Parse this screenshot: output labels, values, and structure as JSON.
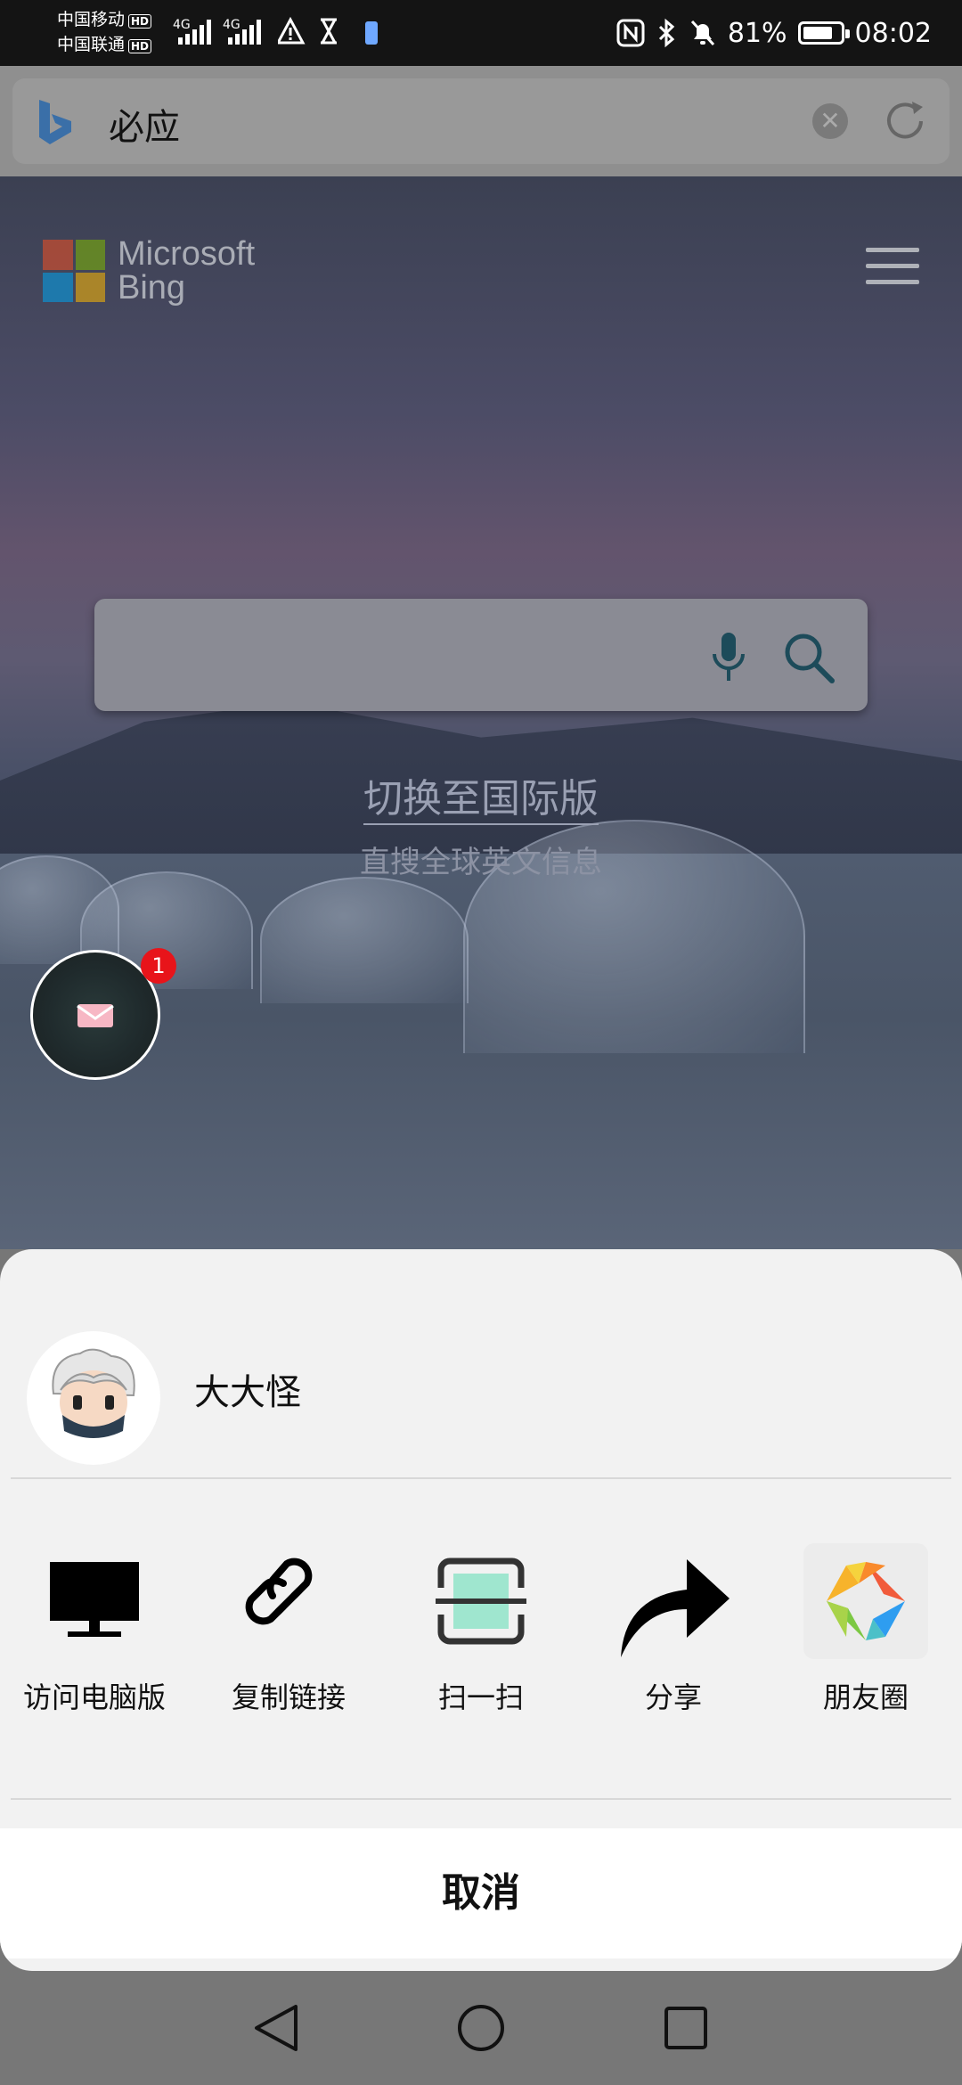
{
  "status_bar": {
    "carrier1": "中国移动",
    "carrier2": "中国联通",
    "hd": "HD",
    "net1": "4G",
    "net2": "4G",
    "battery_percent": "81%",
    "battery_level": 0.81,
    "time": "08:02"
  },
  "address_bar": {
    "text": "必应",
    "clear_icon": "clear-circle-icon",
    "reload_icon": "reload-icon"
  },
  "page": {
    "logo_line1": "Microsoft",
    "logo_line2": "Bing",
    "menu_icon": "hamburger-icon",
    "switch_intl": "切换至国际版",
    "switch_sub": "直搜全球英文信息",
    "float_badge": "1",
    "ms_colors": [
      "#f25022",
      "#7fba00",
      "#00a4ef",
      "#ffb900"
    ]
  },
  "sheet": {
    "username": "大大怪",
    "actions": [
      {
        "label": "访问电脑版",
        "icon": "monitor-icon"
      },
      {
        "label": "复制链接",
        "icon": "link-icon"
      },
      {
        "label": "扫一扫",
        "icon": "scan-icon"
      },
      {
        "label": "分享",
        "icon": "share-arrow-icon"
      },
      {
        "label": "朋友圈",
        "icon": "moments-icon"
      }
    ],
    "cancel": "取消"
  },
  "nav_bar": {
    "back_icon": "back-triangle-icon",
    "home_icon": "home-circle-icon",
    "recents_icon": "recents-square-icon"
  }
}
